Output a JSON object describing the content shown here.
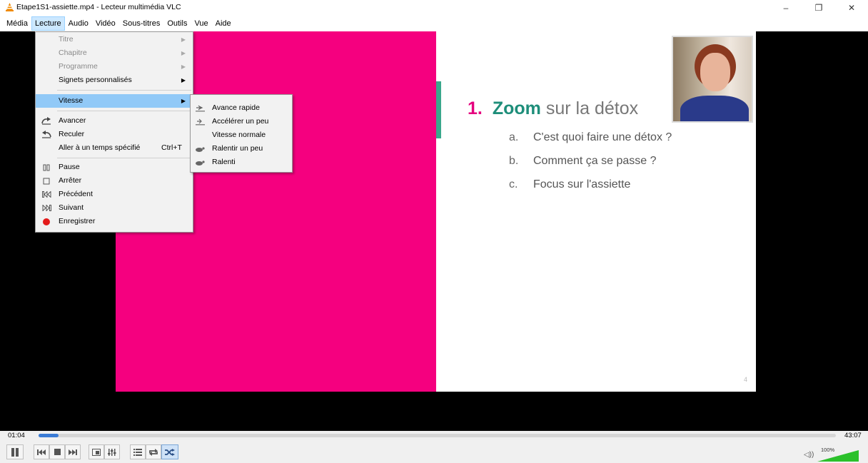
{
  "window": {
    "title": "Etape1S1-assiette.mp4 - Lecteur multimédia VLC",
    "minimize_glyph": "–",
    "maximize_glyph": "❐",
    "close_glyph": "✕"
  },
  "menubar": [
    {
      "label": "Média"
    },
    {
      "label": "Lecture",
      "active": true
    },
    {
      "label": "Audio"
    },
    {
      "label": "Vidéo"
    },
    {
      "label": "Sous-titres"
    },
    {
      "label": "Outils"
    },
    {
      "label": "Vue"
    },
    {
      "label": "Aide"
    }
  ],
  "lecture_menu": {
    "titre": "Titre",
    "chapitre": "Chapitre",
    "programme": "Programme",
    "signets": "Signets personnalisés",
    "vitesse": "Vitesse",
    "avancer": "Avancer",
    "reculer": "Reculer",
    "aller": "Aller à un temps spécifié",
    "aller_shortcut": "Ctrl+T",
    "pause": "Pause",
    "arreter": "Arrêter",
    "precedent": "Précédent",
    "suivant": "Suivant",
    "enregistrer": "Enregistrer",
    "submenu_arrow": "▶"
  },
  "vitesse_submenu": {
    "avance_rapide": "Avance rapide",
    "accelerer": "Accélérer un peu",
    "normale": "Vitesse normale",
    "ralentir": "Ralentir un peu",
    "ralenti": "Ralenti"
  },
  "slide": {
    "number": "1.",
    "zoom": "Zoom",
    "heading_rest": "sur la détox",
    "items": [
      {
        "letter": "a.",
        "text": "C'est quoi faire une détox ?"
      },
      {
        "letter": "b.",
        "text": "Comment ça se passe ?"
      },
      {
        "letter": "c.",
        "text": "Focus sur l'assiette"
      }
    ],
    "page_number": "4",
    "colors": {
      "pink": "#f5007f",
      "teal": "#1e8e7a"
    }
  },
  "player": {
    "elapsed": "01:04",
    "total": "43:07",
    "progress_fraction": 0.025,
    "volume": "100%",
    "volume_fraction": 1.0
  }
}
